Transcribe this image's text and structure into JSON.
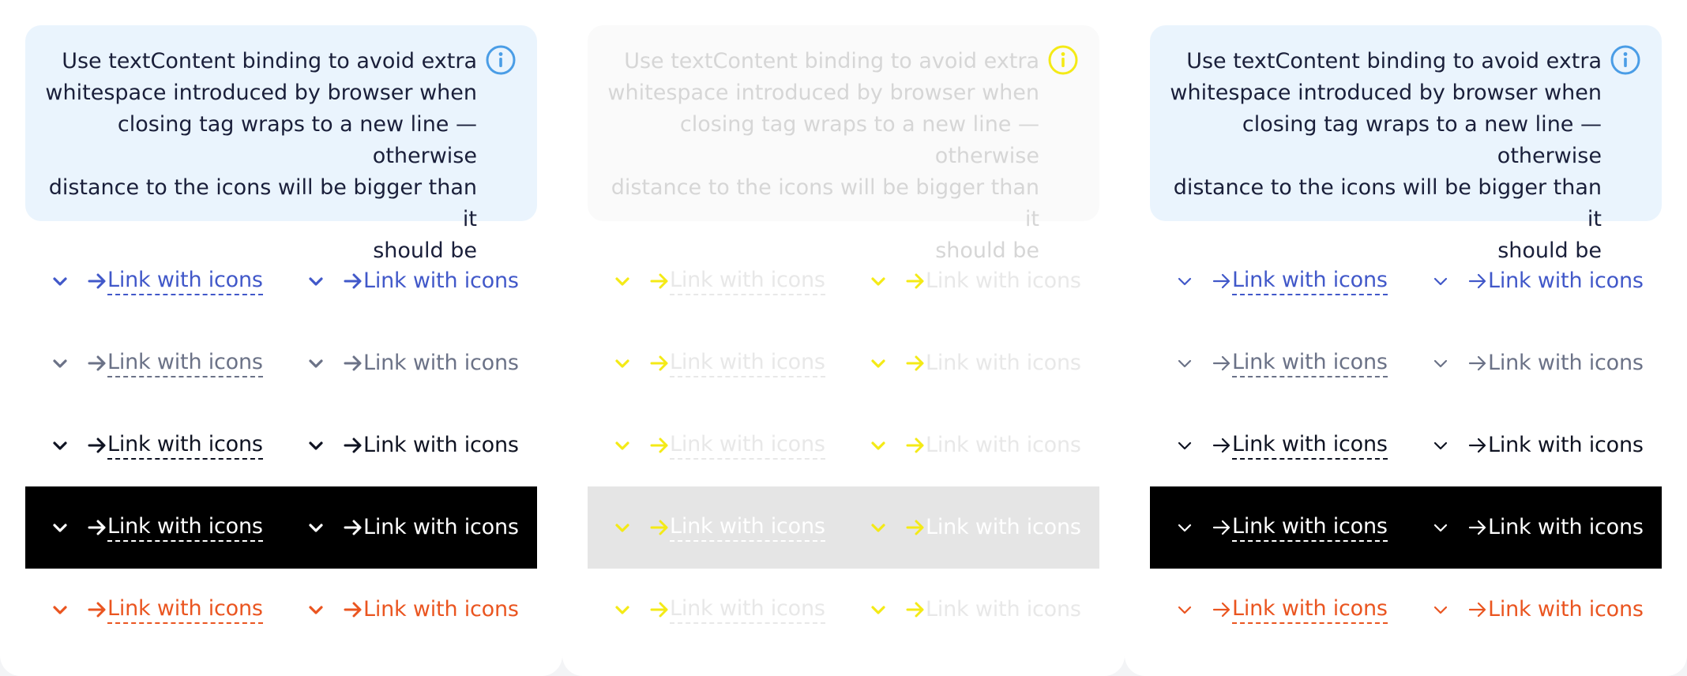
{
  "callout": {
    "text": "Use textContent binding to avoid extra\nwhitespace introduced by browser when\nclosing tag wraps to a new line — otherwise\ndistance to the icons will be bigger than it\nshould be"
  },
  "link_label": "Link with icons",
  "panels": [
    {
      "callout_bg": "#eaf4fd",
      "callout_text_color": "#1a1f3a",
      "info_icon_color": "#4a9de6",
      "rows": [
        {
          "color": "#4158c9",
          "bg": "transparent"
        },
        {
          "color": "#6b7287",
          "bg": "transparent"
        },
        {
          "color": "#0f1322",
          "bg": "transparent"
        },
        {
          "color": "#ffffff",
          "bg": "#000000"
        },
        {
          "color": "#ea5520",
          "bg": "transparent"
        }
      ],
      "chevron_style": "bold"
    },
    {
      "callout_bg": "#fafafa",
      "callout_text_color": "#d6d6d6",
      "info_icon_color": "#f4ea16",
      "rows": [
        {
          "color": "#f4ea16",
          "text_color": "#e8e8e8",
          "bg": "transparent"
        },
        {
          "color": "#f4ea16",
          "text_color": "#e8e8e8",
          "bg": "transparent"
        },
        {
          "color": "#f4ea16",
          "text_color": "#e8e8e8",
          "bg": "transparent"
        },
        {
          "color": "#f4ea16",
          "text_color": "#ffffff",
          "bg": "#e5e5e5"
        },
        {
          "color": "#f4ea16",
          "text_color": "#e8e8e8",
          "bg": "transparent"
        }
      ],
      "chevron_style": "bold"
    },
    {
      "callout_bg": "#eaf4fd",
      "callout_text_color": "#1a1f3a",
      "info_icon_color": "#4a9de6",
      "rows": [
        {
          "color": "#4158c9",
          "bg": "transparent"
        },
        {
          "color": "#6b7287",
          "bg": "transparent"
        },
        {
          "color": "#0f1322",
          "bg": "transparent"
        },
        {
          "color": "#ffffff",
          "bg": "#000000"
        },
        {
          "color": "#ea5520",
          "bg": "transparent"
        }
      ],
      "chevron_style": "thin"
    }
  ]
}
